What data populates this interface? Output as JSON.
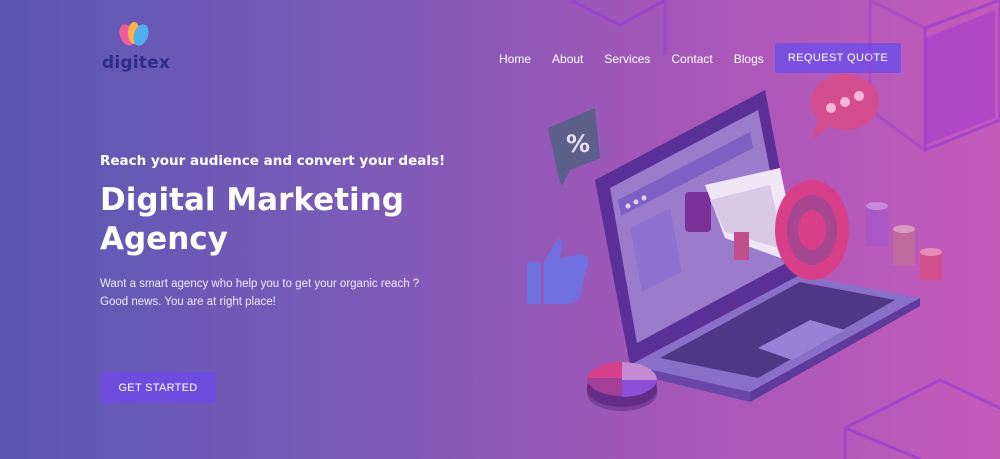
{
  "brand": {
    "name": "digitex"
  },
  "nav": {
    "items": [
      {
        "label": "Home"
      },
      {
        "label": "About"
      },
      {
        "label": "Services"
      },
      {
        "label": "Contact"
      },
      {
        "label": "Blogs"
      }
    ],
    "cta_label": "REQUEST QUOTE"
  },
  "hero": {
    "tagline": "Reach your audience and convert your deals!",
    "title_line1": "Digital Marketing",
    "title_line2": "Agency",
    "description": "Want a smart agency who help you to get your organic reach ? Good news. You are at right place!",
    "cta_label": "GET STARTED"
  },
  "illustration": {
    "badge_symbol": "%"
  },
  "colors": {
    "gradient_start": "#5a58b2",
    "gradient_end": "#c45bbb",
    "button": "#7b4fe0",
    "logo_text": "#2d2c8a"
  },
  "icons": {
    "logo": "heart-logo-icon",
    "percent_badge": "percent-badge-icon",
    "thumbs_up": "thumbs-up-icon",
    "chat": "chat-bubble-icon",
    "megaphone": "megaphone-icon",
    "laptop": "laptop-icon",
    "pie_chart": "pie-chart-icon"
  }
}
